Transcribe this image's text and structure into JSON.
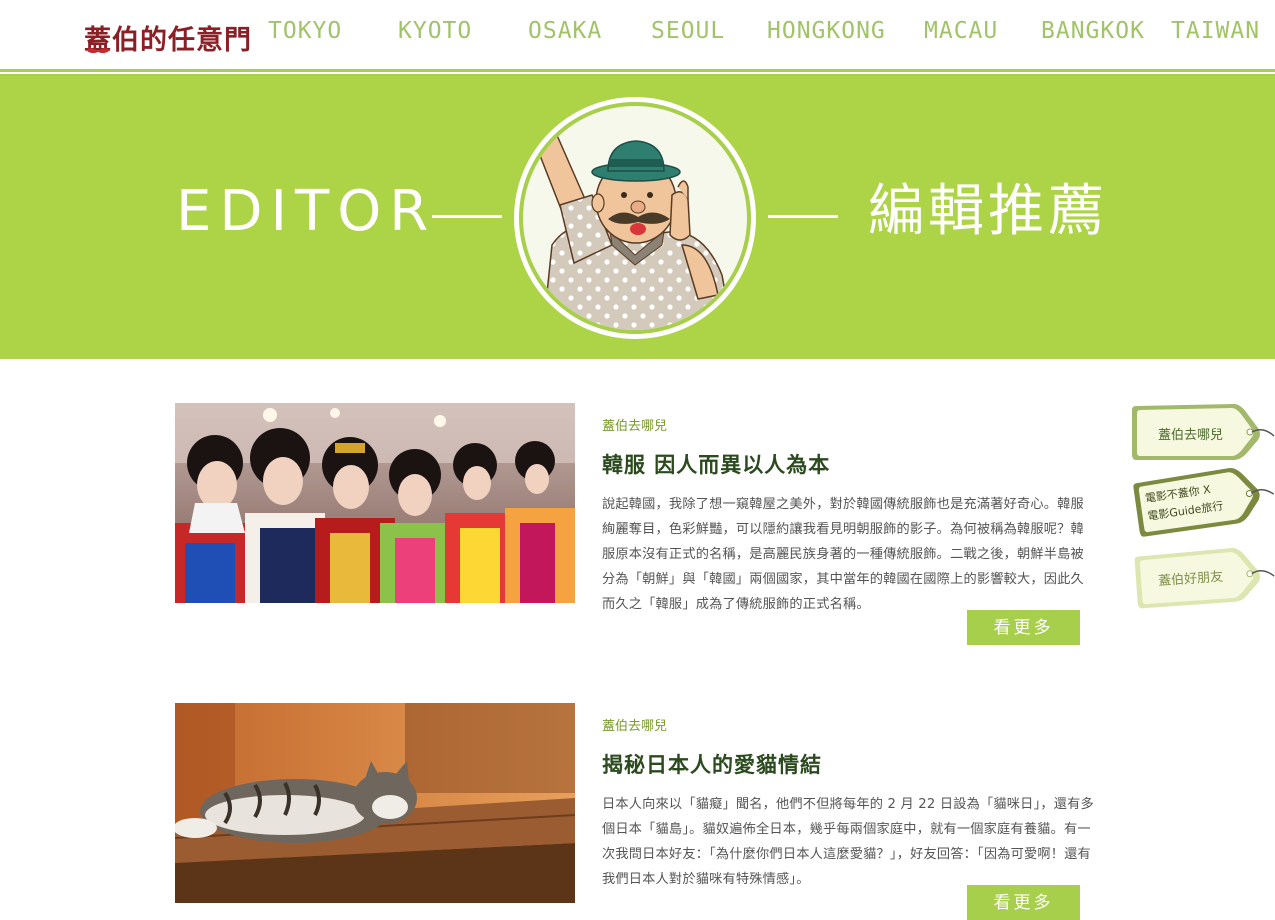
{
  "header": {
    "logo": {
      "text": "蓋伯的任意門",
      "name": "site-logo"
    },
    "nav": [
      "TOKYO",
      "KYOTO",
      "OSAKA",
      "SEOUL",
      "HONGKONG",
      "MACAU",
      "BANGKOK",
      "TAIWAN"
    ]
  },
  "banner": {
    "left_text": "EDITOR",
    "right_text": "編輯推薦",
    "colors": {
      "background": "#add347",
      "text": "#ffffff"
    }
  },
  "articles": [
    {
      "category": "蓋伯去哪兒",
      "title": "韓服 因人而異以人為本",
      "summary": "說起韓國，我除了想一窺韓屋之美外，對於韓國傳統服飾也是充滿著好奇心。韓服絢麗奪目，色彩鮮豔，可以隱約讓我看見明朝服飾的影子。為何被稱為韓服呢？韓服原本沒有正式的名稱，是高麗民族身著的一種傳統服飾。二戰之後，朝鮮半島被分為「朝鮮」與「韓國」兩個國家，其中當年的韓國在國際上的影響較大，因此久而久之「韓服」成為了傳統服飾的正式名稱。",
      "more": "看更多",
      "image": "hanbok-parade-photo"
    },
    {
      "category": "蓋伯去哪兒",
      "title": "揭秘日本人的愛貓情結",
      "summary": "日本人向來以「貓癡」聞名，他們不但將每年的 2 月 22 日設為「貓咪日」，還有多個日本「貓島」。貓奴遍佈全日本，幾乎每兩個家庭中，就有一個家庭有養貓。有一次我問日本好友：「為什麼你們日本人這麼愛貓？」，好友回答：「因為可愛啊！還有我們日本人對於貓咪有特殊情感」。",
      "more": "看更多",
      "image": "sleeping-cat-photo"
    }
  ],
  "side_tags": [
    {
      "label": "蓋伯去哪兒"
    },
    {
      "label_line1": "電影不蓋你 X",
      "label_line2": "電影Guide旅行"
    },
    {
      "label": "蓋伯好朋友"
    }
  ],
  "colors": {
    "accent": "#a7cf4b",
    "nav_text": "#a1c469",
    "title_text": "#2b4a1e",
    "category_text": "#7a9a2b"
  }
}
